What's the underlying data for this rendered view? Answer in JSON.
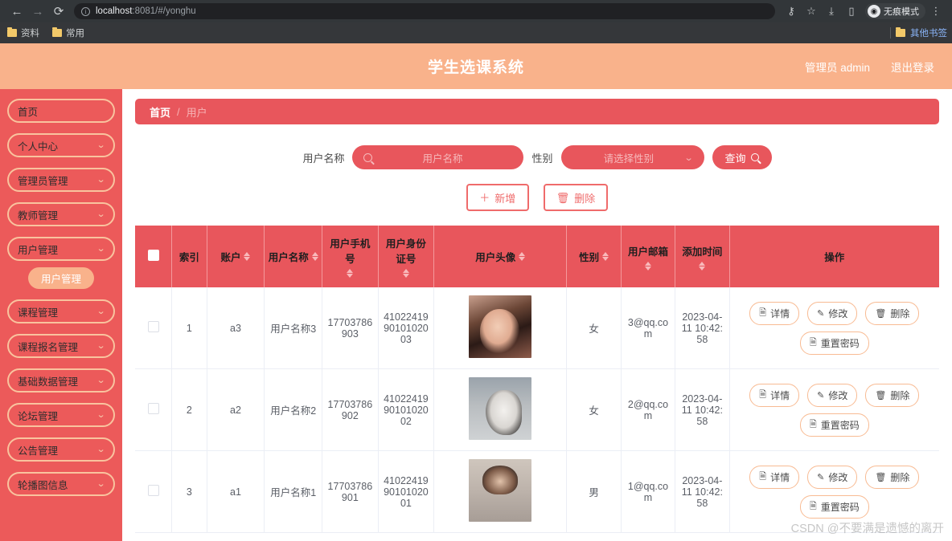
{
  "browser": {
    "back_icon": "←",
    "forward_icon": "→",
    "reload_icon": "⟳",
    "url_prefix": "localhost",
    "url_suffix": ":8081/#/yonghu",
    "key_icon": "⚷",
    "star_icon": "☆",
    "download_icon": "⤓",
    "sidepanel_icon": "▯",
    "incognito_label": "无痕模式",
    "incognito_avatar_icon": "incognito-glasses",
    "menu_icon": "⋮",
    "bookmarks": [
      {
        "label": "资料"
      },
      {
        "label": "常用"
      }
    ],
    "other_bookmarks_label": "其他书签"
  },
  "header": {
    "title": "学生选课系统",
    "admin_label": "管理员 admin",
    "logout_label": "退出登录"
  },
  "sidebar": {
    "items": [
      {
        "label": "首页",
        "has_chevron": false
      },
      {
        "label": "个人中心",
        "has_chevron": true
      },
      {
        "label": "管理员管理",
        "has_chevron": true
      },
      {
        "label": "教师管理",
        "has_chevron": true
      },
      {
        "label": "用户管理",
        "has_chevron": true
      }
    ],
    "active_sub": "用户管理",
    "items_after": [
      {
        "label": "课程管理",
        "has_chevron": true
      },
      {
        "label": "课程报名管理",
        "has_chevron": true
      },
      {
        "label": "基础数据管理",
        "has_chevron": true
      },
      {
        "label": "论坛管理",
        "has_chevron": true
      },
      {
        "label": "公告管理",
        "has_chevron": true
      },
      {
        "label": "轮播图信息",
        "has_chevron": true
      }
    ],
    "chevron_icon": "⌄"
  },
  "breadcrumb": {
    "home": "首页",
    "separator": "/",
    "current": "用户"
  },
  "filters": {
    "name_label": "用户名称",
    "name_placeholder": "用户名称",
    "name_value": "",
    "gender_label": "性别",
    "gender_placeholder": "请选择性别",
    "gender_value": "",
    "search_label": "查询"
  },
  "actions": {
    "add_label": "新增",
    "add_icon": "＋",
    "delete_label": "删除",
    "delete_icon": "🗑"
  },
  "table": {
    "columns": [
      {
        "key": "checkbox",
        "label": "",
        "sortable": false
      },
      {
        "key": "index",
        "label": "索引",
        "sortable": false
      },
      {
        "key": "account",
        "label": "账户",
        "sortable": true
      },
      {
        "key": "username",
        "label": "用户名称",
        "sortable": true
      },
      {
        "key": "phone",
        "label": "用户手机号",
        "sortable": true
      },
      {
        "key": "idcard",
        "label": "用户身份证号",
        "sortable": true
      },
      {
        "key": "avatar",
        "label": "用户头像",
        "sortable": true
      },
      {
        "key": "gender",
        "label": "性别",
        "sortable": true
      },
      {
        "key": "email",
        "label": "用户邮箱",
        "sortable": true
      },
      {
        "key": "created",
        "label": "添加时间",
        "sortable": true
      },
      {
        "key": "ops",
        "label": "操作",
        "sortable": false
      }
    ],
    "rows": [
      {
        "index": "1",
        "account": "a3",
        "username": "用户名称3",
        "phone": "17703786903",
        "idcard": "410224199010102003",
        "avatar_class": "av1",
        "gender": "女",
        "email": "3@qq.com",
        "created": "2023-04-11 10:42:58"
      },
      {
        "index": "2",
        "account": "a2",
        "username": "用户名称2",
        "phone": "17703786902",
        "idcard": "410224199010102002",
        "avatar_class": "av2",
        "gender": "女",
        "email": "2@qq.com",
        "created": "2023-04-11 10:42:58"
      },
      {
        "index": "3",
        "account": "a1",
        "username": "用户名称1",
        "phone": "17703786901",
        "idcard": "410224199010102001",
        "avatar_class": "av3",
        "gender": "男",
        "email": "1@qq.com",
        "created": "2023-04-11 10:42:58"
      }
    ],
    "ops": {
      "detail_label": "详情",
      "detail_icon": "🗎",
      "edit_label": "修改",
      "edit_icon": "✎",
      "delete_label": "删除",
      "delete_icon": "🗑",
      "reset_label": "重置密码",
      "reset_icon": "🗎"
    }
  },
  "watermark": "CSDN @不要满是遗憾的离开",
  "colors": {
    "header_peach": "#f9b28b",
    "sidebar_red": "#ec5a5a",
    "accent_red": "#e8565c",
    "button_outline": "#ef6b6b",
    "op_outline": "#f8bb93"
  }
}
